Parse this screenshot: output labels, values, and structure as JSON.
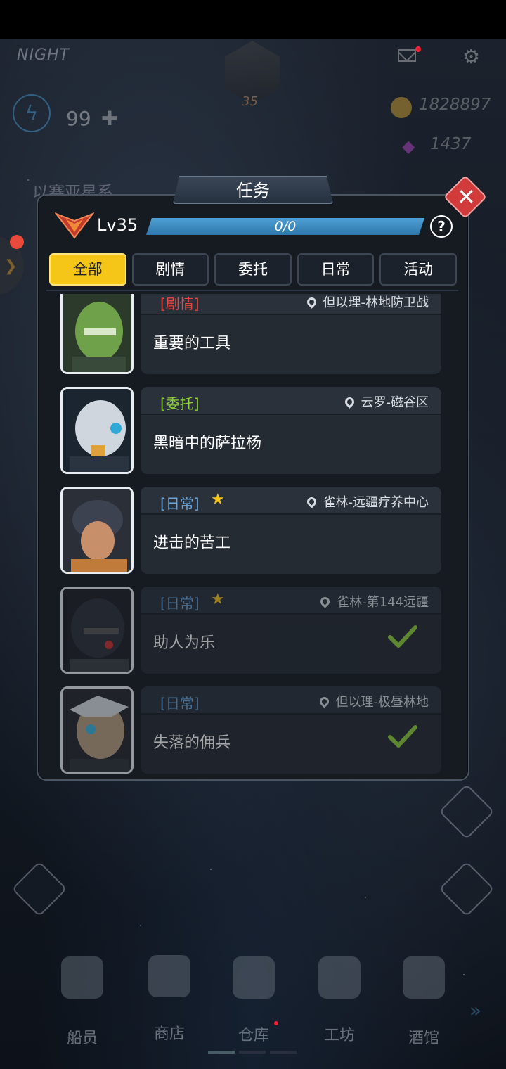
{
  "hud": {
    "time_of_day": "NIGHT",
    "player_level": "35",
    "energy": "99",
    "gold": "1828897",
    "gems": "1437",
    "system_name": "以赛亚星系"
  },
  "dialog": {
    "title": "任务",
    "level": "Lv35",
    "xp_text": "0/0",
    "xp_progress": 1.0,
    "help": "?",
    "tabs": [
      {
        "label": "全部",
        "active": true
      },
      {
        "label": "剧情",
        "active": false
      },
      {
        "label": "委托",
        "active": false
      },
      {
        "label": "日常",
        "active": false
      },
      {
        "label": "活动",
        "active": false
      }
    ],
    "quests": [
      {
        "tag": "[剧情]",
        "type": "story",
        "starred": false,
        "location": "但以理-林地防卫战",
        "name": "重要的工具",
        "done": false
      },
      {
        "tag": "[委托]",
        "type": "commission",
        "starred": false,
        "location": "云罗-磁谷区",
        "name": "黑暗中的萨拉杨",
        "done": false
      },
      {
        "tag": "[日常]",
        "type": "daily",
        "starred": true,
        "location": "雀林-远疆疗养中心",
        "name": "进击的苦工",
        "done": false
      },
      {
        "tag": "[日常]",
        "type": "daily",
        "starred": true,
        "location": "雀林-第144远疆",
        "name": "助人为乐",
        "done": true
      },
      {
        "tag": "[日常]",
        "type": "daily",
        "starred": false,
        "location": "但以理-极昼林地",
        "name": "失落的佣兵",
        "done": true
      }
    ]
  },
  "bottom_nav": [
    {
      "label": "船员"
    },
    {
      "label": "商店"
    },
    {
      "label": "仓库"
    },
    {
      "label": "工坊"
    },
    {
      "label": "酒馆"
    }
  ],
  "colors": {
    "accent_yellow": "#f5c518",
    "story": "#e5463d",
    "commission": "#8fcf3c",
    "daily": "#6aa6dc",
    "xp_bar": "#3f8ec4",
    "close": "#d23b3b"
  }
}
